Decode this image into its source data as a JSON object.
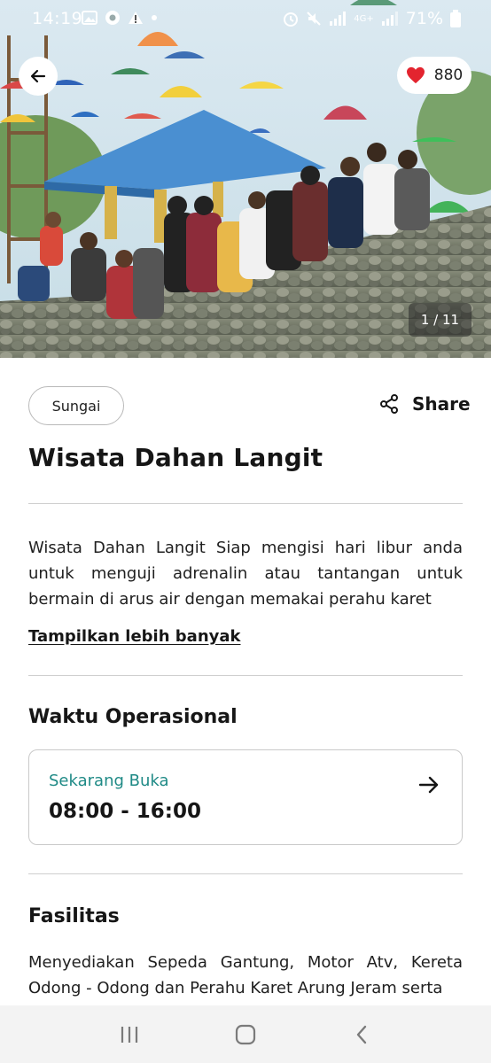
{
  "status_bar": {
    "time": "14:19",
    "battery": "71%",
    "network": "4G+"
  },
  "hero": {
    "likes": "880",
    "counter": "1 / 11",
    "colors": {
      "sky": "#cfe3ee",
      "roof": "#4a8fd1",
      "rocks": "#6f7466"
    }
  },
  "place": {
    "category": "Sungai",
    "share_label": "Share",
    "name": "Wisata Dahan Langit",
    "description": "Wisata Dahan Langit Siap mengisi hari libur anda untuk menguji adrenalin atau tantangan untuk bermain di arus air dengan memakai perahu karet",
    "show_more": "Tampilkan lebih banyak"
  },
  "hours": {
    "heading": "Waktu Operasional",
    "status": "Sekarang Buka",
    "range": "08:00 - 16:00",
    "status_color": "#1f8a86"
  },
  "facilities": {
    "heading": "Fasilitas",
    "text": "Menyediakan Sepeda Gantung, Motor Atv, Kereta Odong - Odong dan Perahu Karet Arung Jeram serta"
  },
  "icons": {
    "back": "arrow-left-icon",
    "like": "heart-icon",
    "share": "share-icon",
    "hours_arrow": "arrow-right-icon",
    "nav_recents": "recents-icon",
    "nav_home": "home-icon",
    "nav_back": "chevron-left-icon"
  }
}
